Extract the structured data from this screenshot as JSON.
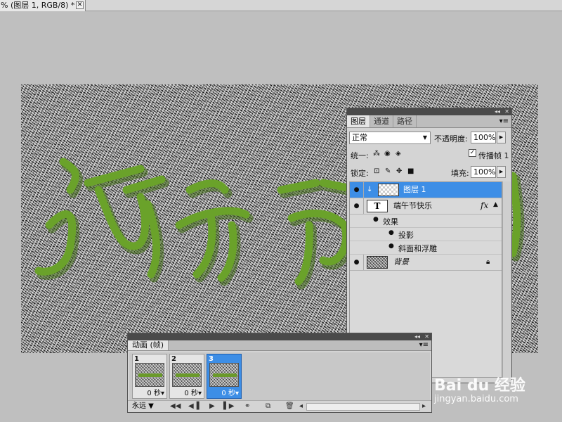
{
  "document_tab": {
    "title": "% (图层 1, RGB/8) *",
    "close_glyph": "✕"
  },
  "layers_panel": {
    "tabs": [
      "图层",
      "通道",
      "路径"
    ],
    "menu_glyph": "▾≡",
    "blend_mode": "正常",
    "opacity_label": "不透明度:",
    "opacity_value": "100%",
    "unify_label": "统一:",
    "propagate_label": "传播帧 1",
    "lock_label": "锁定:",
    "fill_label": "填充:",
    "fill_value": "100%",
    "layers": [
      {
        "name": "图层 1",
        "selected": true
      },
      {
        "name": "端午节快乐",
        "selected": false,
        "fx": "fx"
      },
      {
        "name": "背景",
        "selected": false
      }
    ],
    "effects_label": "效果",
    "effects": [
      "投影",
      "斜面和浮雕"
    ]
  },
  "animation_panel": {
    "tab_label": "动画 (帧)",
    "frames": [
      {
        "number": "1",
        "delay": "0 秒"
      },
      {
        "number": "2",
        "delay": "0 秒"
      },
      {
        "number": "3",
        "delay": "0 秒",
        "selected": true
      }
    ],
    "loop_option": "永远"
  },
  "canvas": {
    "text_art_color": "#6aa22a"
  },
  "watermark": {
    "logo": "Bai du 经验",
    "url": "jingyan.baidu.com"
  }
}
